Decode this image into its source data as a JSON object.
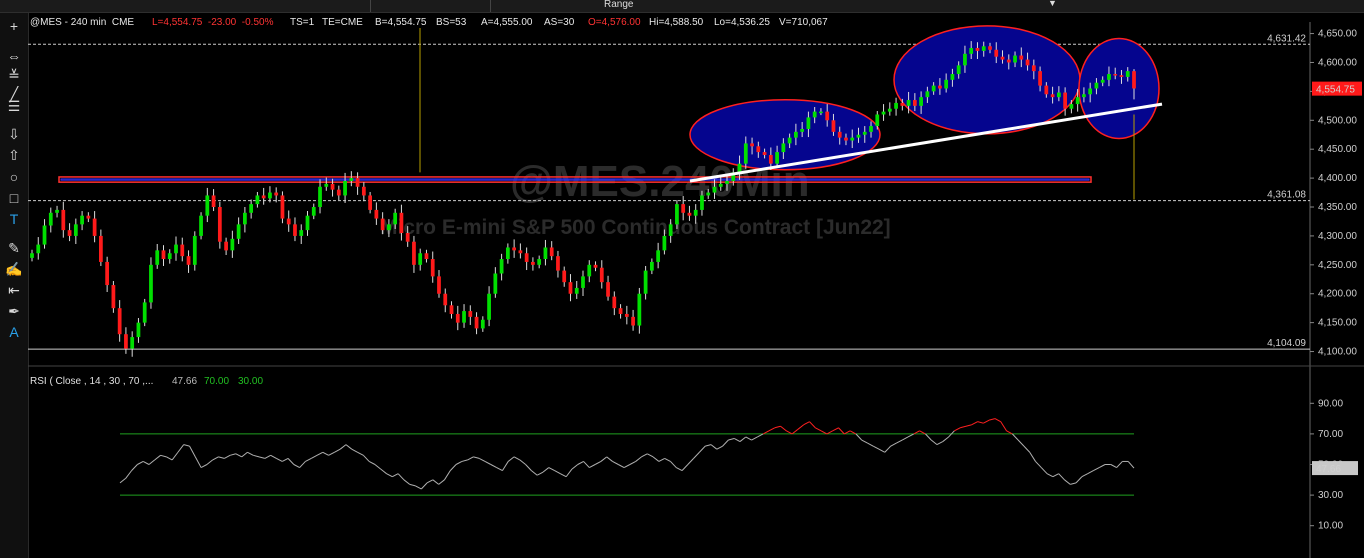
{
  "range_selector": {
    "label": "Range"
  },
  "header": {
    "symbol": "@MES - 240 min  CME",
    "last": "L=4,554.75  -23.00  -0.50%",
    "ts": "TS=1",
    "te": "TE=CME",
    "bid": "B=4,554.75",
    "bs": "BS=53",
    "ask": "A=4,555.00",
    "as": "AS=30",
    "open": "O=4,576.00",
    "hi": "Hi=4,588.50",
    "lo": "Lo=4,536.25",
    "vol": "V=710,067"
  },
  "watermark": {
    "symbol": "@MES.240Min",
    "name": "Micro E-mini S&P 500 Continuous Contract [Jun22]"
  },
  "rsi_header": {
    "label": "RSI ( Close , 14 , 30 , 70 ,... ",
    "value": "47.66",
    "overbought": "70.00",
    "oversold": "30.00"
  },
  "chart_data": [
    {
      "type": "candlestick",
      "ylim": [
        4075,
        4670
      ],
      "yticks": [
        "4,100.00",
        "4,150.00",
        "4,200.00",
        "4,250.00",
        "4,300.00",
        "4,350.00",
        "4,400.00",
        "4,450.00",
        "4,500.00",
        "4,550.00",
        "4,600.00",
        "4,650.00"
      ],
      "ytick_values": [
        4100,
        4150,
        4200,
        4250,
        4300,
        4350,
        4400,
        4450,
        4500,
        4550,
        4600,
        4650
      ],
      "last_price_label": "4,554.75",
      "last_price": 4554.75,
      "reference_lines": [
        {
          "label": "4,631.42",
          "value": 4631.42
        },
        {
          "label": "4,361.08",
          "value": 4361.08
        },
        {
          "label": "4,104.09",
          "value": 4104.09
        }
      ],
      "resistance_zone": [
        4393,
        4402
      ],
      "close": [
        4270,
        4285,
        4318,
        4340,
        4345,
        4310,
        4300,
        4320,
        4335,
        4330,
        4300,
        4255,
        4215,
        4175,
        4130,
        4105,
        4125,
        4150,
        4185,
        4250,
        4275,
        4260,
        4270,
        4285,
        4265,
        4250,
        4300,
        4335,
        4370,
        4350,
        4290,
        4275,
        4295,
        4320,
        4340,
        4355,
        4370,
        4365,
        4375,
        4370,
        4330,
        4320,
        4300,
        4310,
        4335,
        4350,
        4385,
        4390,
        4380,
        4370,
        4395,
        4400,
        4385,
        4370,
        4345,
        4330,
        4310,
        4320,
        4340,
        4305,
        4290,
        4250,
        4270,
        4260,
        4230,
        4200,
        4180,
        4165,
        4150,
        4170,
        4160,
        4140,
        4155,
        4200,
        4235,
        4260,
        4280,
        4275,
        4270,
        4255,
        4250,
        4260,
        4280,
        4265,
        4240,
        4220,
        4200,
        4210,
        4230,
        4250,
        4245,
        4220,
        4195,
        4175,
        4165,
        4160,
        4145,
        4200,
        4240,
        4255,
        4275,
        4300,
        4320,
        4355,
        4340,
        4335,
        4345,
        4370,
        4375,
        4385,
        4390,
        4395,
        4410,
        4425,
        4460,
        4455,
        4445,
        4440,
        4425,
        4445,
        4460,
        4470,
        4480,
        4485,
        4505,
        4515,
        4515,
        4500,
        4480,
        4470,
        4465,
        4470,
        4475,
        4480,
        4490,
        4510,
        4515,
        4520,
        4530,
        4525,
        4535,
        4525,
        4540,
        4550,
        4560,
        4555,
        4570,
        4580,
        4595,
        4615,
        4625,
        4620,
        4628,
        4622,
        4610,
        4605,
        4600,
        4612,
        4605,
        4595,
        4585,
        4560,
        4545,
        4540,
        4548,
        4520,
        4528,
        4540,
        4545,
        4555,
        4565,
        4570,
        4580,
        4578,
        4575,
        4585,
        4555
      ],
      "hi_last": 4588.5,
      "lo_last": 4536.25
    },
    {
      "type": "line",
      "title": "RSI",
      "ylim": [
        0,
        100
      ],
      "yticks": [
        "10.00",
        "30.00",
        "50.00",
        "70.00",
        "90.00"
      ],
      "ytick_values": [
        10,
        30,
        50,
        70,
        90
      ],
      "overbought": 70,
      "oversold": 30,
      "last_value_label": "47.66",
      "values": [
        38,
        41,
        46,
        50,
        52,
        50,
        53,
        56,
        55,
        53,
        58,
        63,
        62,
        55,
        48,
        50,
        53,
        55,
        54,
        56,
        57,
        55,
        58,
        56,
        55,
        54,
        56,
        54,
        52,
        54,
        50,
        48,
        52,
        54,
        56,
        58,
        56,
        58,
        60,
        63,
        60,
        58,
        56,
        52,
        50,
        47,
        44,
        42,
        44,
        40,
        37,
        36,
        34,
        38,
        40,
        37,
        40,
        46,
        50,
        52,
        53,
        55,
        54,
        52,
        50,
        48,
        46,
        52,
        55,
        53,
        50,
        46,
        43,
        45,
        48,
        46,
        44,
        42,
        47,
        50,
        52,
        48,
        50,
        52,
        55,
        52,
        50,
        48,
        50,
        52,
        55,
        57,
        55,
        52,
        54,
        52,
        48,
        46,
        50,
        54,
        58,
        62,
        63,
        60,
        62,
        66,
        67,
        65,
        68,
        66,
        68,
        70,
        72,
        74,
        75,
        72,
        70,
        73,
        76,
        78,
        74,
        72,
        70,
        72,
        74,
        70,
        72,
        70,
        66,
        64,
        62,
        60,
        58,
        62,
        64,
        66,
        68,
        70,
        72,
        70,
        66,
        63,
        65,
        68,
        72,
        74,
        75,
        76,
        78,
        77,
        79,
        80,
        78,
        72,
        70,
        66,
        62,
        58,
        52,
        48,
        44,
        42,
        44,
        40,
        37,
        38,
        42,
        44,
        46,
        48,
        50,
        50,
        48,
        52,
        52,
        47.66
      ]
    }
  ]
}
